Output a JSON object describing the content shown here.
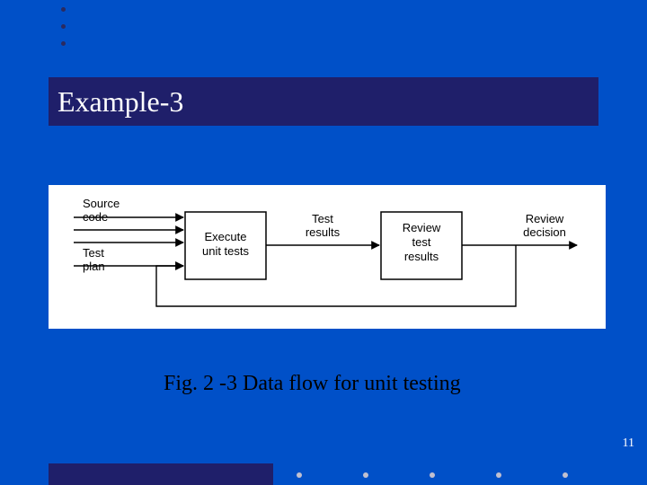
{
  "title": "Example-3",
  "caption": "Fig. 2 -3 Data flow for unit testing",
  "page_number": "11",
  "diagram": {
    "inputs": {
      "source_l1": "Source",
      "source_l2": "code",
      "testplan_l1": "Test",
      "testplan_l2": "plan"
    },
    "box1_l1": "Execute",
    "box1_l2": "unit tests",
    "mid_l1": "Test",
    "mid_l2": "results",
    "box2_l1": "Review",
    "box2_l2": "test",
    "box2_l3": "results",
    "out_l1": "Review",
    "out_l2": "decision"
  }
}
